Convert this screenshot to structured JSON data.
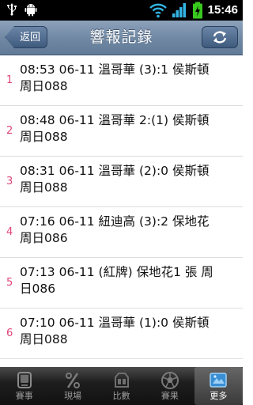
{
  "status_bar": {
    "time": "15:46"
  },
  "header": {
    "back_label": "返回",
    "title": "響報記錄"
  },
  "items": [
    {
      "index": "1",
      "text": "08:53 06-11 溫哥華 (3):1 侯斯頓\n周日088"
    },
    {
      "index": "2",
      "text": "08:48 06-11 溫哥華 2:(1) 侯斯頓\n周日088"
    },
    {
      "index": "3",
      "text": "08:31 06-11 溫哥華 (2):0 侯斯頓\n周日088"
    },
    {
      "index": "4",
      "text": "07:16 06-11 紐迪高 (3):2 保地花\n周日086"
    },
    {
      "index": "5",
      "text": "07:13 06-11 (紅牌) 保地花1 張 周\n日086"
    },
    {
      "index": "6",
      "text": "07:10 06-11 溫哥華 (1):0 侯斯頓\n周日088"
    }
  ],
  "bottom_nav": {
    "tabs": [
      {
        "label": "賽事",
        "icon": "monitor-icon"
      },
      {
        "label": "現場",
        "icon": "percent-icon"
      },
      {
        "label": "比數",
        "icon": "scoreboard-icon"
      },
      {
        "label": "賽果",
        "icon": "football-icon"
      },
      {
        "label": "更多",
        "icon": "more-icon"
      }
    ],
    "active_index": 4
  },
  "colors": {
    "title_bar": "#6f87a2",
    "index_number": "#e0457b",
    "status_bar": "#000000",
    "battery": "#39c81f"
  }
}
